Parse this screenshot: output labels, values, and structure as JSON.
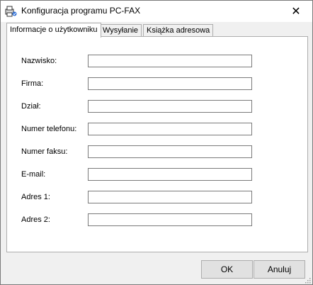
{
  "window": {
    "title": "Konfiguracja programu PC-FAX",
    "close_glyph": "✕"
  },
  "tabs": [
    {
      "label": "Informacje o użytkowniku",
      "active": true
    },
    {
      "label": "Wysyłanie",
      "active": false
    },
    {
      "label": "Książka adresowa",
      "active": false
    }
  ],
  "form": {
    "fields": [
      {
        "label": "Nazwisko:",
        "value": ""
      },
      {
        "label": "Firma:",
        "value": ""
      },
      {
        "label": "Dział:",
        "value": ""
      },
      {
        "label": "Numer telefonu:",
        "value": ""
      },
      {
        "label": "Numer faksu:",
        "value": ""
      },
      {
        "label": "E-mail:",
        "value": ""
      },
      {
        "label": "Adres 1:",
        "value": ""
      },
      {
        "label": "Adres 2:",
        "value": ""
      }
    ]
  },
  "buttons": {
    "ok_label": "OK",
    "cancel_label": "Anuluj"
  },
  "icons": {
    "app": "fax-printer-icon",
    "close": "close-icon",
    "resize": "resize-grip-icon"
  }
}
